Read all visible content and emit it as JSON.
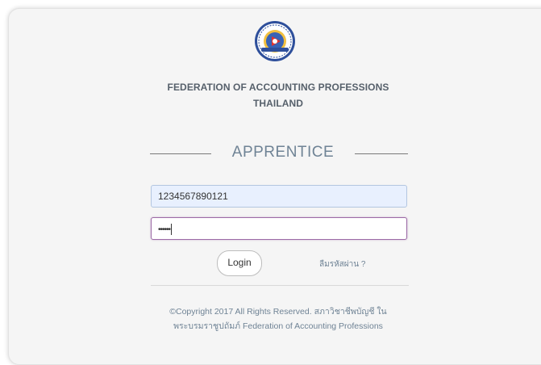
{
  "org": {
    "line1": "FEDERATION OF ACCOUNTING PROFESSIONS",
    "line2": "THAILAND"
  },
  "form": {
    "title": "APPRENTICE",
    "username_value": "1234567890121",
    "password_mask": "••••••",
    "login_label": "Login",
    "forgot_label": "ลืมรหัสผ่าน ?"
  },
  "footer": {
    "line1": "©Copyright 2017 All Rights Reserved. สภาวิชาชีพบัญชี ใน",
    "line2": "พระบรมราชูปถัมภ์ Federation of Accounting Professions"
  },
  "icons": {
    "logo": "fap-logo-icon"
  },
  "colors": {
    "accent_text": "#6f8395",
    "focused_border": "#9c6aa6",
    "autofill_bg": "#e8f0fe"
  }
}
